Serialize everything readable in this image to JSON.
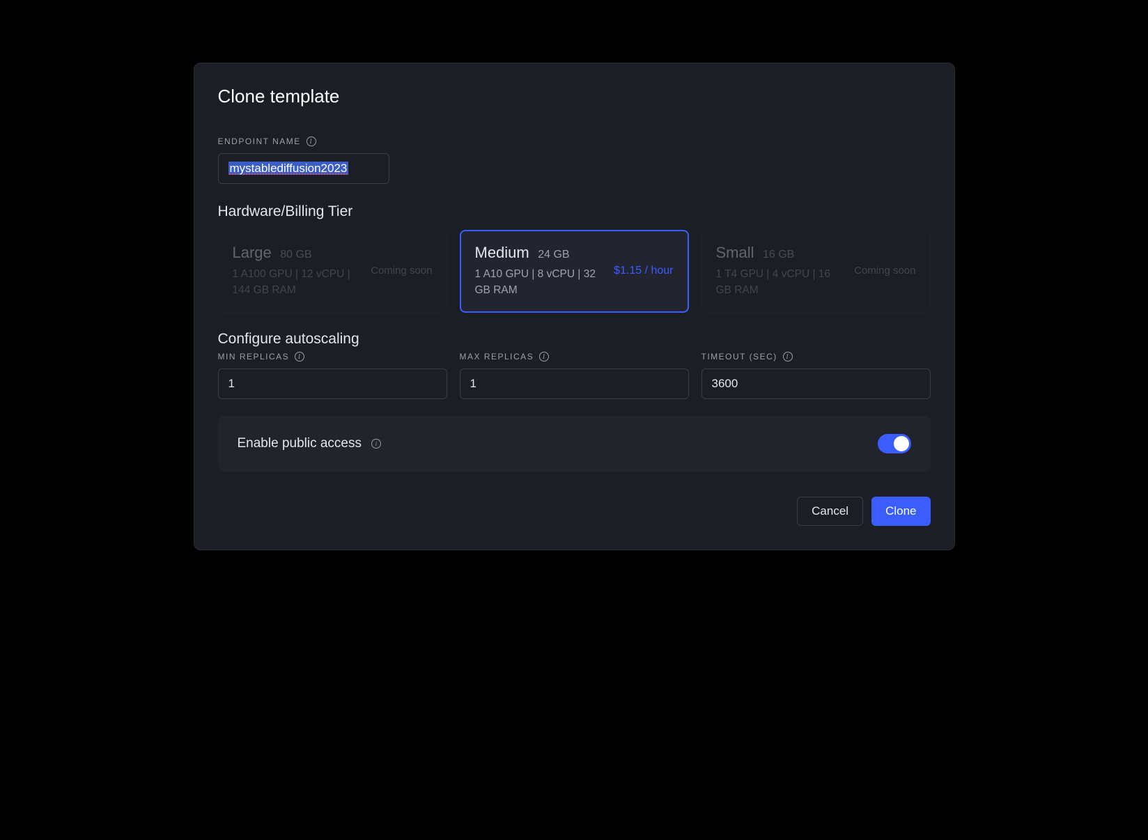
{
  "modal": {
    "title": "Clone template"
  },
  "endpoint": {
    "label": "ENDPOINT NAME",
    "value": "mystablediffusion2023"
  },
  "hardware": {
    "heading": "Hardware/Billing Tier",
    "tiers": [
      {
        "name": "Large",
        "size": "80 GB",
        "specs": "1 A100 GPU | 12 vCPU | 144 GB RAM",
        "status": "Coming soon",
        "selected": false,
        "disabled": true
      },
      {
        "name": "Medium",
        "size": "24 GB",
        "specs": "1 A10 GPU | 8 vCPU | 32 GB RAM",
        "price": "$1.15 / hour",
        "selected": true,
        "disabled": false
      },
      {
        "name": "Small",
        "size": "16 GB",
        "specs": "1 T4 GPU | 4 vCPU | 16 GB RAM",
        "status": "Coming soon",
        "selected": false,
        "disabled": true
      }
    ]
  },
  "autoscale": {
    "heading": "Configure autoscaling",
    "min": {
      "label": "MIN REPLICAS",
      "value": "1"
    },
    "max": {
      "label": "MAX REPLICAS",
      "value": "1"
    },
    "timeout": {
      "label": "TIMEOUT (SEC)",
      "value": "3600"
    }
  },
  "publicAccess": {
    "label": "Enable public access",
    "enabled": true
  },
  "footer": {
    "cancel": "Cancel",
    "clone": "Clone"
  }
}
